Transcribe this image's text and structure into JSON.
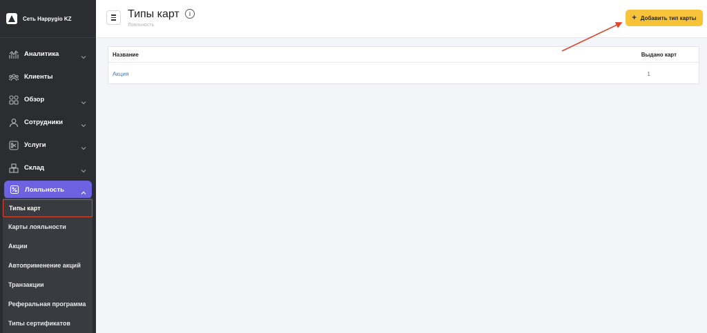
{
  "brand": {
    "name": "Сеть Happygio KZ"
  },
  "nav": [
    {
      "label": "Аналитика",
      "icon": "analytics-icon",
      "chevron": true
    },
    {
      "label": "Клиенты",
      "icon": "clients-icon",
      "chevron": false
    },
    {
      "label": "Обзор",
      "icon": "overview-icon",
      "chevron": true
    },
    {
      "label": "Сотрудники",
      "icon": "user-icon",
      "chevron": true
    },
    {
      "label": "Услуги",
      "icon": "scissors-icon",
      "chevron": true
    },
    {
      "label": "Склад",
      "icon": "warehouse-icon",
      "chevron": true
    },
    {
      "label": "Лояльность",
      "icon": "loyalty-icon",
      "chevron": true,
      "active": true
    }
  ],
  "subnav": [
    "Типы карт",
    "Карты лояльности",
    "Акции",
    "Автоприменение акций",
    "Транзакции",
    "Реферальная программа",
    "Типы сертификатов"
  ],
  "header": {
    "title": "Типы карт",
    "breadcrumb": "Лояльность",
    "add_label": "Добавить тип карты",
    "add_icon": "+"
  },
  "table": {
    "columns": [
      "Название",
      "Выдано карт"
    ],
    "rows": [
      {
        "name": "Акция",
        "count": "1"
      }
    ]
  },
  "colors": {
    "sidebar": "#2c2d31",
    "accent": "#6d63e0",
    "button": "#f7c338",
    "link": "#3b7fbd",
    "annotation": "#e0442a"
  }
}
